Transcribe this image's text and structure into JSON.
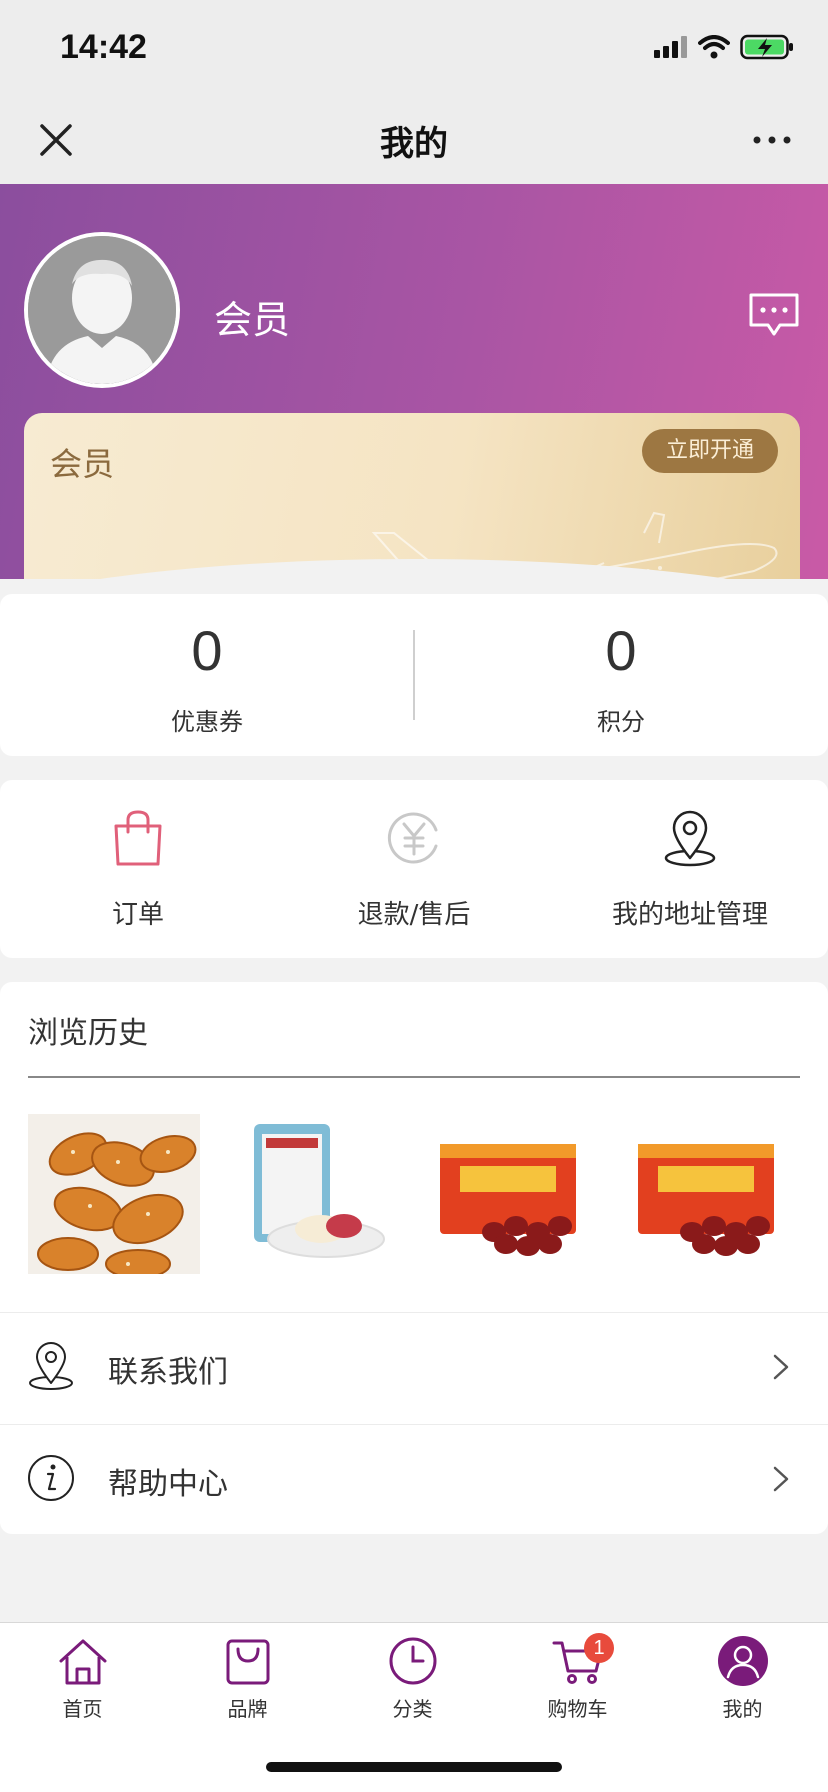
{
  "status_bar": {
    "time": "14:42"
  },
  "nav": {
    "title": "我的"
  },
  "profile": {
    "name": "会员"
  },
  "member_card": {
    "label": "会员",
    "open_button": "立即开通"
  },
  "stats": [
    {
      "value": "0",
      "label": "优惠券"
    },
    {
      "value": "0",
      "label": "积分"
    }
  ],
  "actions": [
    {
      "label": "订单",
      "icon": "shopping-bag-icon"
    },
    {
      "label": "退款/售后",
      "icon": "refund-yuan-icon"
    },
    {
      "label": "我的地址管理",
      "icon": "location-pin-icon"
    }
  ],
  "history": {
    "title": "浏览历史"
  },
  "menu": [
    {
      "label": "联系我们",
      "icon": "location-pin-icon"
    },
    {
      "label": "帮助中心",
      "icon": "info-icon"
    }
  ],
  "tabs": [
    {
      "label": "首页",
      "icon": "home-icon"
    },
    {
      "label": "品牌",
      "icon": "bag-icon"
    },
    {
      "label": "分类",
      "icon": "clock-icon"
    },
    {
      "label": "购物车",
      "icon": "cart-icon",
      "badge": "1"
    },
    {
      "label": "我的",
      "icon": "profile-icon",
      "active": true
    }
  ],
  "colors": {
    "accent": "#7a1b7a",
    "header_start": "#8b4e9e",
    "header_end": "#c95aa6",
    "gold": "#9d7742",
    "badge": "#e84b3c"
  }
}
